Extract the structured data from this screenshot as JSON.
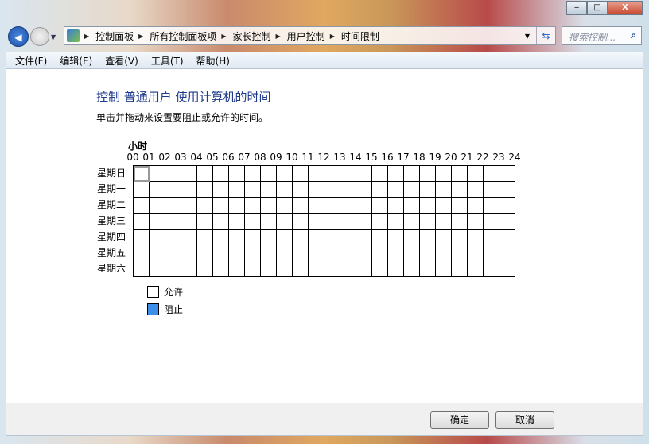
{
  "window": {
    "minimize": "‒",
    "maximize": "□",
    "close": "X"
  },
  "nav": {
    "back_icon": "back-arrow-icon",
    "forward_icon": "forward-arrow-icon"
  },
  "breadcrumb": [
    "控制面板",
    "所有控制面板项",
    "家长控制",
    "用户控制",
    "时间限制"
  ],
  "search": {
    "placeholder": "搜索控制..."
  },
  "menu": [
    "文件(F)",
    "编辑(E)",
    "查看(V)",
    "工具(T)",
    "帮助(H)"
  ],
  "main": {
    "title": "控制 普通用户 使用计算机的时间",
    "instruction": "单击并拖动来设置要阻止或允许的时间。",
    "hour_label": "小时",
    "hours": [
      "00",
      "01",
      "02",
      "03",
      "04",
      "05",
      "06",
      "07",
      "08",
      "09",
      "10",
      "11",
      "12",
      "13",
      "14",
      "15",
      "16",
      "17",
      "18",
      "19",
      "20",
      "21",
      "22",
      "23",
      "24"
    ],
    "days": [
      "星期日",
      "星期一",
      "星期二",
      "星期三",
      "星期四",
      "星期五",
      "星期六"
    ],
    "blocked_cells": [],
    "legend": {
      "allow": "允许",
      "block": "阻止",
      "allow_color": "#ffffff",
      "block_color": "#3d8ee8"
    }
  },
  "footer": {
    "ok": "确定",
    "cancel": "取消"
  }
}
